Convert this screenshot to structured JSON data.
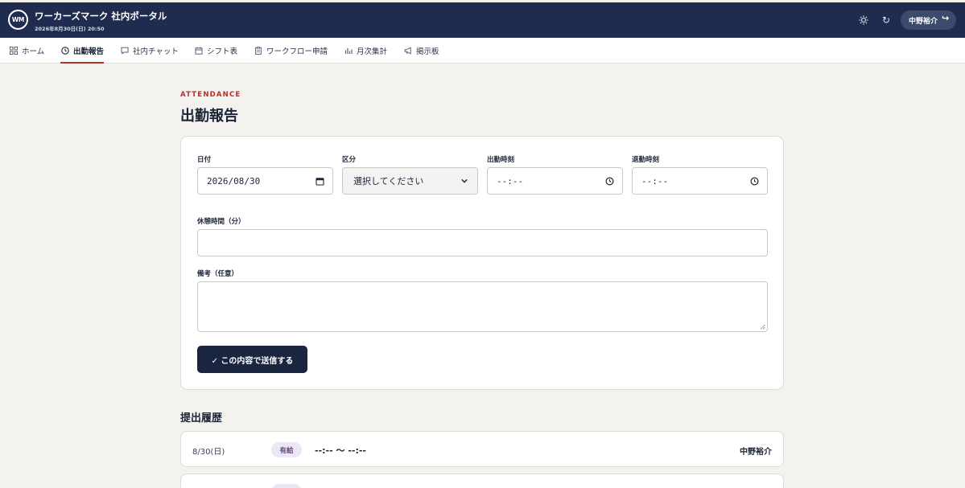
{
  "header": {
    "logo_text": "WM",
    "app_title": "ワーカーズマーク 社内ポータル",
    "datetime": "2026年8月30日(日) 20:50",
    "icons": [
      "theme-toggle-icon",
      "refresh-icon",
      "logout-icon"
    ],
    "user_name": "中野裕介"
  },
  "nav": {
    "items": [
      {
        "label": "ホーム",
        "icon": "grid-icon"
      },
      {
        "label": "出勤報告",
        "icon": "clock-icon",
        "active": true
      },
      {
        "label": "社内チャット",
        "icon": "chat-icon"
      },
      {
        "label": "シフト表",
        "icon": "calendar-icon"
      },
      {
        "label": "ワークフロー申請",
        "icon": "clipboard-icon"
      },
      {
        "label": "月次集計",
        "icon": "bar-chart-icon"
      },
      {
        "label": "掲示板",
        "icon": "megaphone-icon"
      }
    ]
  },
  "page": {
    "eyebrow": "ATTENDANCE",
    "title": "出勤報告"
  },
  "form": {
    "date": {
      "label": "日付",
      "value": "2026/08/30"
    },
    "category": {
      "label": "区分",
      "value": "選択してください"
    },
    "start_time": {
      "label": "出勤時刻",
      "value": "--:--"
    },
    "end_time": {
      "label": "退勤時刻",
      "value": "--:--"
    },
    "break_minutes": {
      "label": "休憩時間（分）",
      "value": ""
    },
    "notes": {
      "label": "備考（任意）",
      "value": ""
    },
    "submit_label": "✓ この内容で送信する"
  },
  "history": {
    "title": "提出履歴",
    "rows": [
      {
        "date": "8/30(日)",
        "badge": "有給",
        "time": "--:-- 〜 --:--",
        "name": "中野裕介"
      }
    ]
  },
  "colors": {
    "header_bg": "#1f2c4f",
    "accent": "#b4322c",
    "button_bg": "#1a2640",
    "page_bg": "#f3f2ee"
  }
}
